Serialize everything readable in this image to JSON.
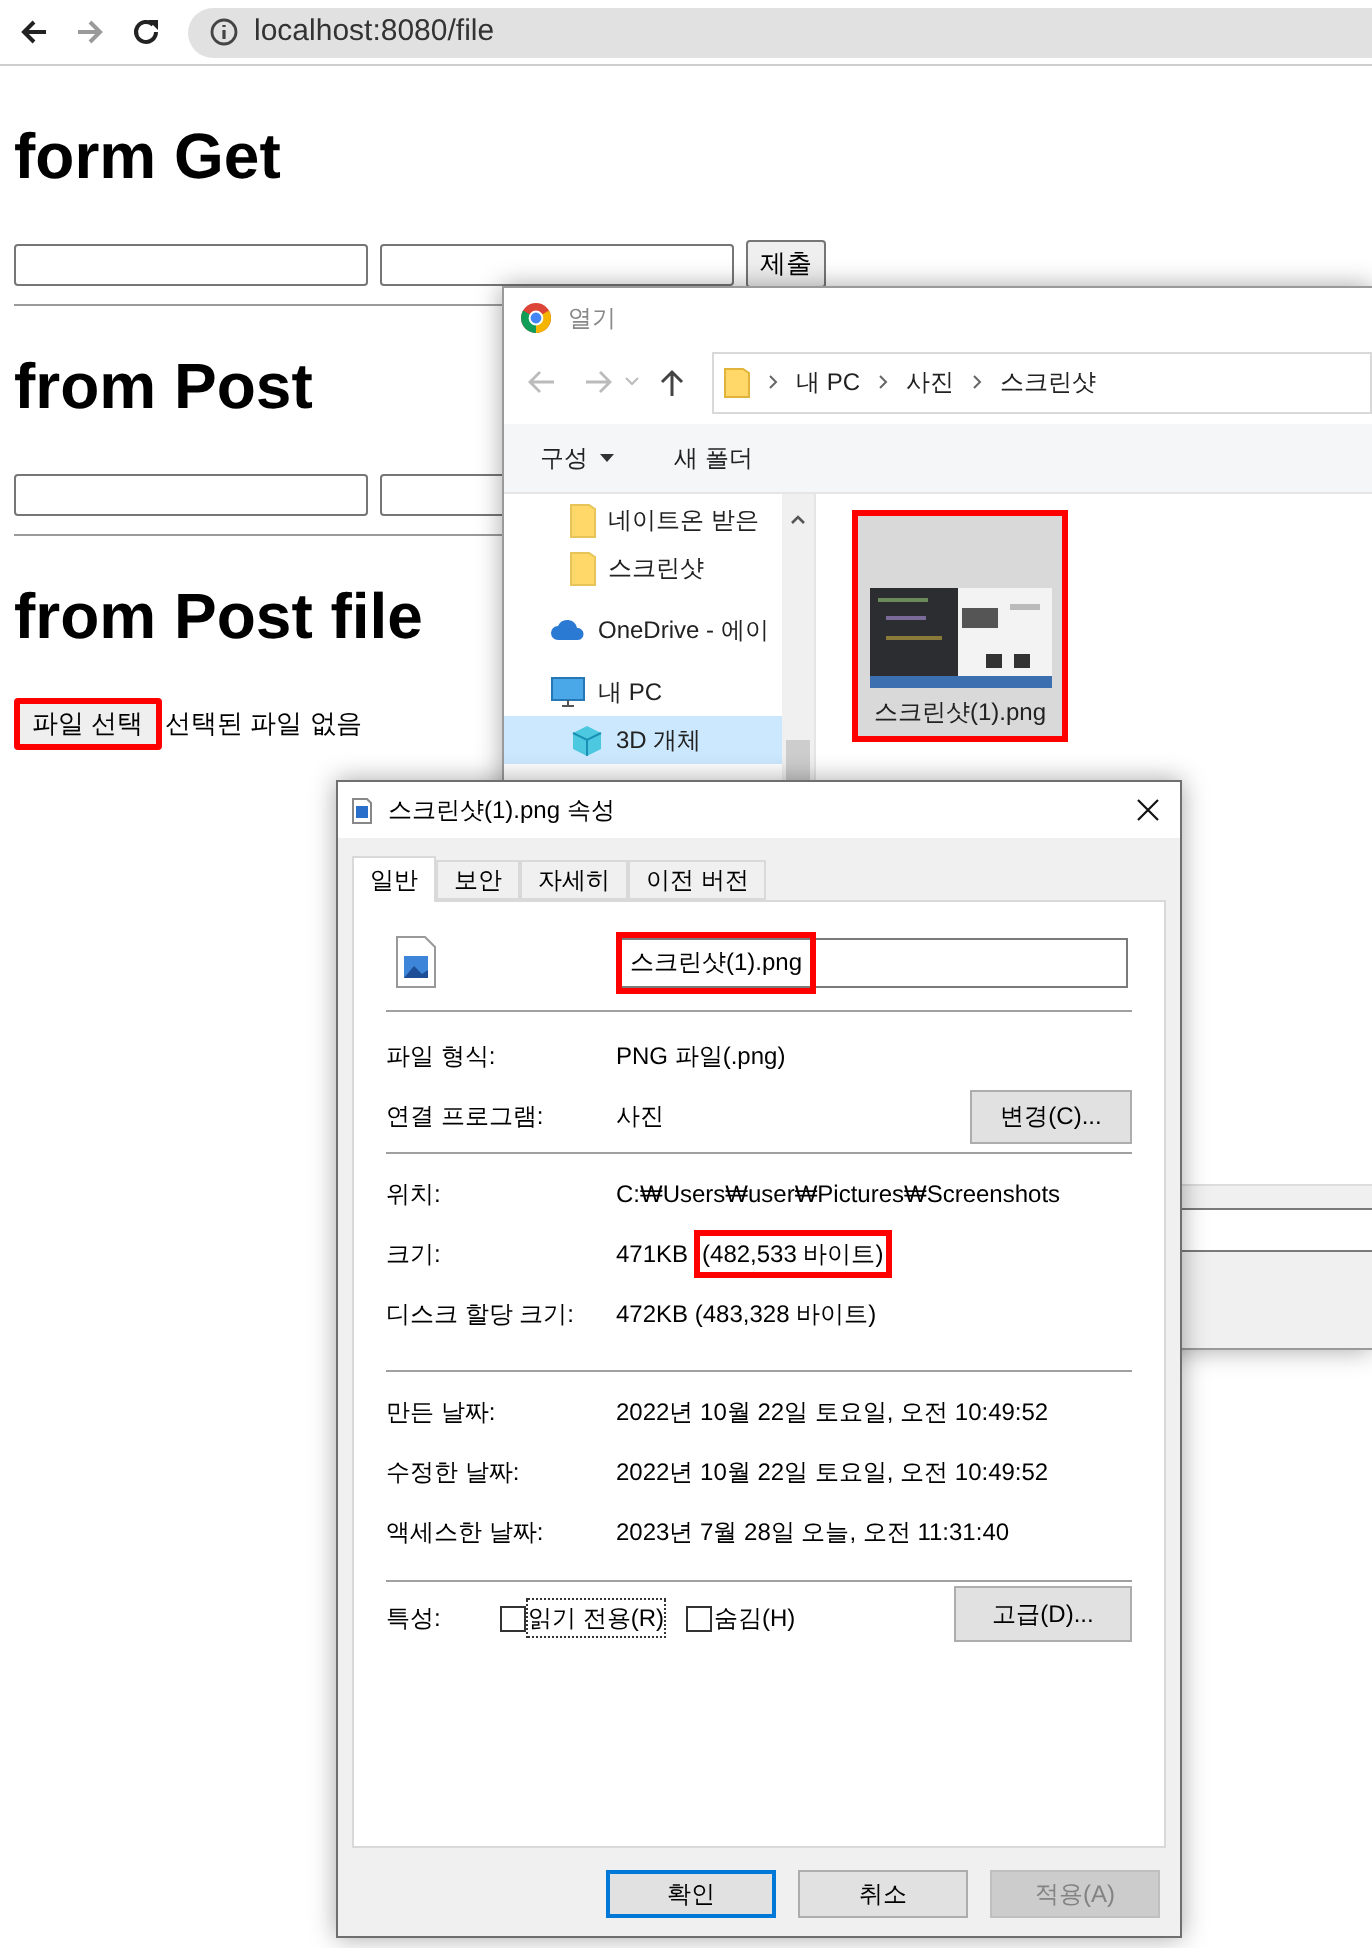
{
  "browser": {
    "url": "localhost:8080/file",
    "forward_disabled": true
  },
  "page": {
    "sections": [
      {
        "heading": "form Get",
        "kind": "text_pair",
        "button": "제출"
      },
      {
        "heading": "from Post",
        "kind": "text_pair"
      },
      {
        "heading": "from Post file",
        "kind": "file",
        "button": "파일 선택",
        "status": "선택된 파일 없음",
        "highlighted": true
      }
    ]
  },
  "open_dialog": {
    "title": "열기",
    "breadcrumb": [
      "내 PC",
      "사진",
      "스크린샷"
    ],
    "toolbar": [
      {
        "label": "구성",
        "dropdown": true
      },
      {
        "label": "새 폴더",
        "dropdown": false
      }
    ],
    "nav_items": [
      {
        "label": "네이트온 받은",
        "kind": "folder",
        "selected": false
      },
      {
        "label": "스크린샷",
        "kind": "folder",
        "selected": false
      },
      {
        "label": "OneDrive - 에이",
        "kind": "cloud",
        "selected": false
      },
      {
        "label": "내 PC",
        "kind": "pc",
        "selected": false,
        "children": [
          {
            "label": "3D 개체",
            "kind": "cube",
            "selected": true
          }
        ]
      }
    ],
    "files": [
      {
        "name": "스크린샷(1).png",
        "selected": true,
        "highlighted": true
      }
    ]
  },
  "properties": {
    "title": "스크린샷(1).png 속성",
    "tabs": [
      {
        "label": "일반",
        "selected": true
      },
      {
        "label": "보안",
        "selected": false
      },
      {
        "label": "자세히",
        "selected": false
      },
      {
        "label": "이전 버전",
        "selected": false
      }
    ],
    "file_name": {
      "value": "스크린샷(1).png",
      "highlighted": true
    },
    "groups": [
      [
        {
          "label": "파일 형식:",
          "value": "PNG 파일(.png)"
        },
        {
          "label": "연결 프로그램:",
          "value": "사진",
          "button": "변경(C)..."
        }
      ],
      [
        {
          "label": "위치:",
          "value": "C:₩Users₩user₩Pictures₩Screenshots"
        },
        {
          "label": "크기:",
          "value": "471KB",
          "highlighted_value": "(482,533 바이트)"
        },
        {
          "label": "디스크 할당 크기:",
          "value": "472KB (483,328 바이트)"
        }
      ],
      [
        {
          "label": "만든 날짜:",
          "value": "2022년 10월 22일 토요일, 오전 10:49:52"
        },
        {
          "label": "수정한 날짜:",
          "value": "2022년 10월 22일 토요일, 오전 10:49:52"
        },
        {
          "label": "액세스한 날짜:",
          "value": "2023년 7월 28일 오늘, 오전 11:31:40"
        }
      ]
    ],
    "attributes": {
      "label": "특성:",
      "checkboxes": [
        {
          "label": "읽기 전용(R)",
          "checked": false,
          "focused": true
        },
        {
          "label": "숨김(H)",
          "checked": false,
          "focused": false
        }
      ],
      "button": "고급(D)..."
    },
    "buttons": [
      {
        "label": "확인",
        "kind": "default",
        "disabled": false
      },
      {
        "label": "취소",
        "kind": "normal",
        "disabled": false
      },
      {
        "label": "적용(A)",
        "kind": "normal",
        "disabled": true
      }
    ]
  }
}
